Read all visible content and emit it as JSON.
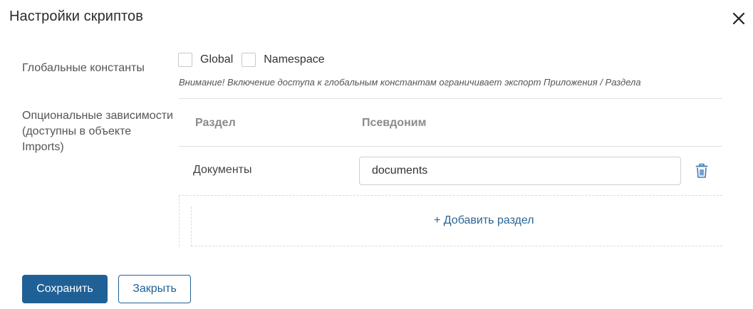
{
  "dialog": {
    "title": "Настройки скриптов",
    "close_icon": "close-icon"
  },
  "global_constants": {
    "label": "Глобальные константы",
    "options": [
      {
        "label": "Global",
        "checked": false
      },
      {
        "label": "Namespace",
        "checked": false
      }
    ],
    "warning": "Внимание! Включение доступа к глобальным константам ограничивает экспорт Приложения / Раздела"
  },
  "dependencies": {
    "label": "Опциональные зависимости (доступны в объекте Imports)",
    "columns": {
      "section": "Раздел",
      "alias": "Псевдоним"
    },
    "rows": [
      {
        "section": "Документы",
        "alias": "documents",
        "delete_icon": "trash-icon"
      }
    ],
    "add_label": "+ Добавить раздел"
  },
  "footer": {
    "save_label": "Сохранить",
    "close_label": "Закрыть"
  },
  "colors": {
    "primary": "#1f6196",
    "link": "#2a6496",
    "icon": "#3a7ab8"
  }
}
